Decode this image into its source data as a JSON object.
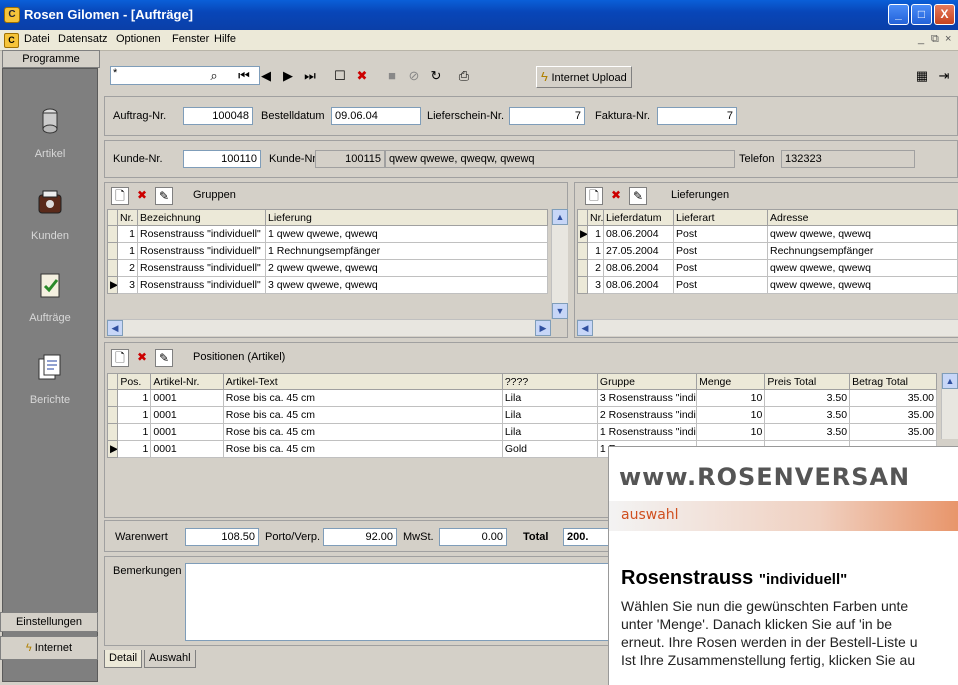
{
  "window": {
    "title": "Rosen Gilomen - [Aufträge]"
  },
  "menu": {
    "items": [
      "Datei",
      "Datensatz",
      "Optionen",
      "Fenster",
      "Hilfe"
    ]
  },
  "sidebar": {
    "header": "Programme",
    "items": [
      {
        "label": "Artikel",
        "icon": "articles-icon"
      },
      {
        "label": "Kunden",
        "icon": "customers-icon"
      },
      {
        "label": "Aufträge",
        "icon": "orders-icon"
      },
      {
        "label": "Berichte",
        "icon": "reports-icon"
      }
    ],
    "settings": "Einstellungen",
    "internet": "Internet"
  },
  "toolbar": {
    "search_value": "*",
    "upload_label": "Internet Upload"
  },
  "order": {
    "auftrag_label": "Auftrag-Nr.",
    "auftrag_value": "100048",
    "bestell_label": "Bestelldatum",
    "bestell_value": "09.06.04",
    "liefer_label": "Lieferschein-Nr.",
    "liefer_value": "7",
    "faktura_label": "Faktura-Nr.",
    "faktura_value": "7",
    "kunde_label": "Kunde-Nr.",
    "kunde_value": "100110",
    "kunde2_label": "Kunde-Nr.",
    "kunde2_value": "100115",
    "kunde2_name": "qwew qwewe, qweqw, qwewq",
    "telefon_label": "Telefon",
    "telefon_value": "132323"
  },
  "gruppen": {
    "title": "Gruppen",
    "columns": [
      "Nr.",
      "Bezeichnung",
      "Lieferung"
    ],
    "rows": [
      [
        "1",
        "Rosenstrauss \"individuell\"",
        "1 qwew qwewe, qwewq"
      ],
      [
        "1",
        "Rosenstrauss \"individuell\"",
        "1 Rechnungsempfänger"
      ],
      [
        "2",
        "Rosenstrauss \"individuell\"",
        "2 qwew qwewe, qwewq"
      ],
      [
        "3",
        "Rosenstrauss \"individuell\"",
        "3 qwew qwewe, qwewq"
      ]
    ]
  },
  "lieferungen": {
    "title": "Lieferungen",
    "columns": [
      "Nr.",
      "Lieferdatum",
      "Lieferart",
      "Adresse"
    ],
    "rows": [
      [
        "1",
        "08.06.2004",
        "Post",
        "qwew qwewe, qwewq"
      ],
      [
        "1",
        "27.05.2004",
        "Post",
        "Rechnungsempfänger"
      ],
      [
        "2",
        "08.06.2004",
        "Post",
        "qwew qwewe, qwewq"
      ],
      [
        "3",
        "08.06.2004",
        "Post",
        "qwew qwewe, qwewq"
      ]
    ]
  },
  "positionen": {
    "title": "Positionen (Artikel)",
    "columns": [
      "Pos.",
      "Artikel-Nr.",
      "Artikel-Text",
      "????",
      "Gruppe",
      "Menge",
      "Preis Total",
      "Betrag Total"
    ],
    "rows": [
      [
        "1",
        "0001",
        "Rose bis ca. 45 cm",
        "Lila",
        "3 Rosenstrauss \"indi",
        "10",
        "3.50",
        "35.00"
      ],
      [
        "1",
        "0001",
        "Rose bis ca. 45 cm",
        "Lila",
        "2 Rosenstrauss \"indi",
        "10",
        "3.50",
        "35.00"
      ],
      [
        "1",
        "0001",
        "Rose bis ca. 45 cm",
        "Lila",
        "1 Rosenstrauss \"indi",
        "10",
        "3.50",
        "35.00"
      ],
      [
        "1",
        "0001",
        "Rose bis ca. 45 cm",
        "Gold",
        "1 Ro",
        "",
        "",
        ""
      ]
    ]
  },
  "totals": {
    "warenwert_label": "Warenwert",
    "warenwert_value": "108.50",
    "porto_label": "Porto/Verp.",
    "porto_value": "92.00",
    "mwst_label": "MwSt.",
    "mwst_value": "0.00",
    "total_label": "Total",
    "total_value": "200."
  },
  "bemerkungen_label": "Bemerkungen",
  "tabs": [
    "Detail",
    "Auswahl"
  ],
  "overlay": {
    "banner": "www.ROSENVERSAN",
    "bar_text": "auswahl",
    "heading": "Rosenstrauss",
    "heading_small": "\"individuell\"",
    "lines": [
      "Wählen Sie nun die gewünschten Farben unte",
      "unter 'Menge'. Danach klicken Sie auf 'in be",
      "erneut. Ihre Rosen werden in der Bestell-Liste u",
      "Ist Ihre Zusammenstellung fertig, klicken Sie au"
    ]
  },
  "colors": {
    "titlebar": "#0846b8",
    "sidebar": "#7f7f7f",
    "accent": "#e8956a"
  }
}
